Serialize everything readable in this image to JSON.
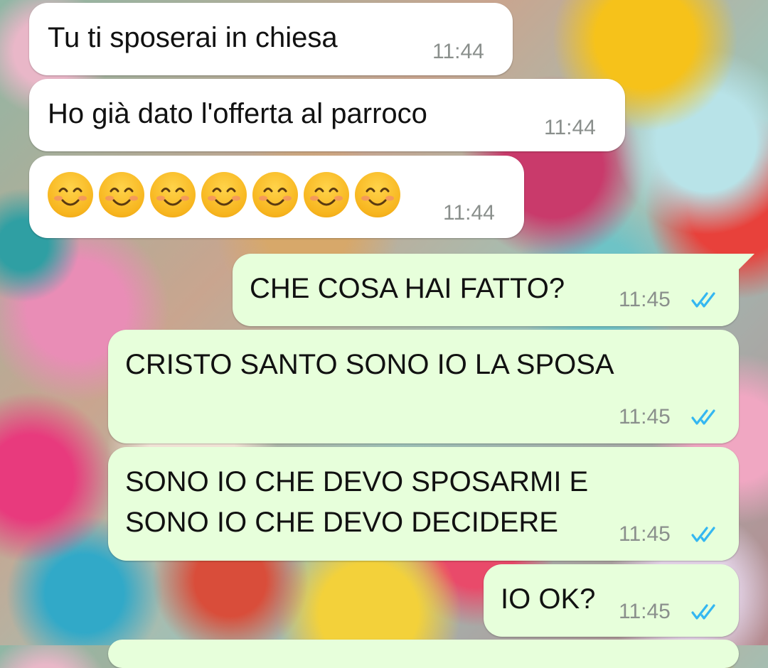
{
  "conversation": {
    "messages": [
      {
        "direction": "incoming",
        "text": "Tu ti sposerai in chiesa",
        "time": "11:44"
      },
      {
        "direction": "incoming",
        "text": "Ho già dato l'offerta al parroco",
        "time": "11:44"
      },
      {
        "direction": "incoming",
        "emoji_name": "smiling-face-with-smiling-eyes-icon",
        "emoji_count": 7,
        "time": "11:44"
      },
      {
        "direction": "outgoing",
        "text": "CHE COSA HAI FATTO?",
        "time": "11:45",
        "status": "read"
      },
      {
        "direction": "outgoing",
        "text": "CRISTO SANTO SONO IO LA SPOSA",
        "time": "11:45",
        "status": "read"
      },
      {
        "direction": "outgoing",
        "text_lines": [
          "SONO IO CHE DEVO SPOSARMI E",
          "SONO IO CHE DEVO DECIDERE"
        ],
        "time": "11:45",
        "status": "read"
      },
      {
        "direction": "outgoing",
        "text": "IO OK?",
        "time": "11:45",
        "status": "read"
      }
    ]
  },
  "colors": {
    "incoming_bubble": "#ffffff",
    "outgoing_bubble": "#e7ffdb",
    "read_ticks": "#34b7f1",
    "timestamp": "#8a8f8c"
  }
}
